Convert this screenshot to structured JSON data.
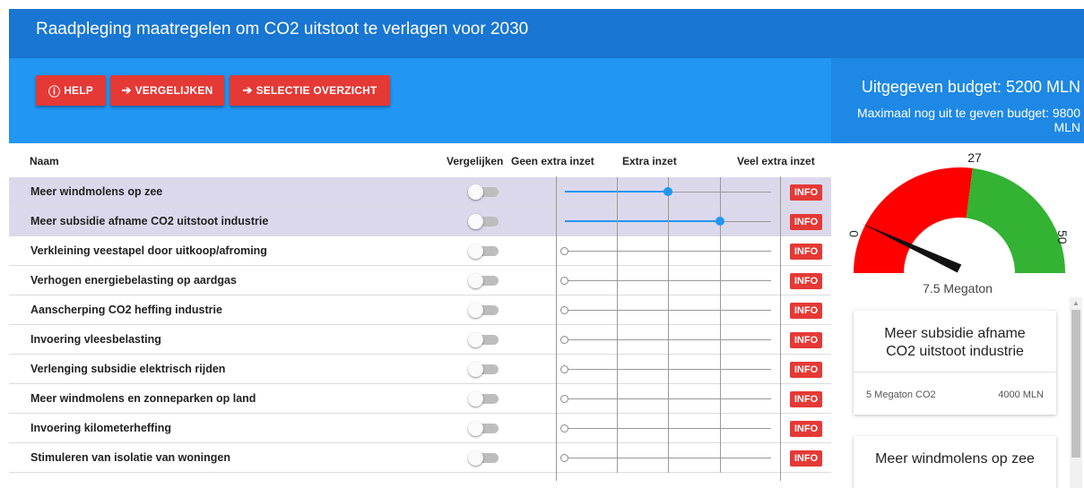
{
  "title": "Raadpleging maatregelen om CO2 uitstoot te verlagen voor 2030",
  "toolbar": {
    "help_label": "HELP",
    "compare_label": "VERGELIJKEN",
    "selection_label": "SELECTIE OVERZICHT"
  },
  "budget": {
    "spent": "Uitgegeven budget: 5200 MLN",
    "remaining": "Maximaal nog uit te geven budget: 9800 MLN"
  },
  "table": {
    "headers": {
      "name": "Naam",
      "compare": "Vergelijken",
      "none": "Geen extra inzet",
      "extra": "Extra inzet",
      "much": "Veel extra inzet"
    },
    "info_label": "INFO",
    "rows": [
      {
        "name": "Meer windmolens op zee",
        "selected": true,
        "level": 0.5
      },
      {
        "name": "Meer subsidie afname CO2 uitstoot industrie",
        "selected": true,
        "level": 0.75
      },
      {
        "name": "Verkleining veestapel door uitkoop/afroming",
        "selected": false,
        "level": 0
      },
      {
        "name": "Verhogen energiebelasting op aardgas",
        "selected": false,
        "level": 0
      },
      {
        "name": "Aanscherping CO2 heffing industrie",
        "selected": false,
        "level": 0
      },
      {
        "name": "Invoering vleesbelasting",
        "selected": false,
        "level": 0
      },
      {
        "name": "Verlenging subsidie elektrisch rijden",
        "selected": false,
        "level": 0
      },
      {
        "name": "Meer windmolens en zonneparken op land",
        "selected": false,
        "level": 0
      },
      {
        "name": "Invoering kilometerheffing",
        "selected": false,
        "level": 0
      },
      {
        "name": "Stimuleren van isolatie van woningen",
        "selected": false,
        "level": 0
      }
    ]
  },
  "gauge": {
    "min": "0",
    "target": "27",
    "max": "50",
    "value": 7.5,
    "value_label": "7.5 Megaton",
    "colors": {
      "low": "#ff0000",
      "high": "#33b233"
    }
  },
  "cards": [
    {
      "title": "Meer subsidie afname CO2 uitstoot industrie",
      "co2": "5 Megaton CO2",
      "cost": "4000 MLN"
    },
    {
      "title": "Meer windmolens op zee"
    }
  ],
  "colors": {
    "primary": "#2196f3",
    "dark": "#1976d2",
    "accent": "#e53935"
  }
}
